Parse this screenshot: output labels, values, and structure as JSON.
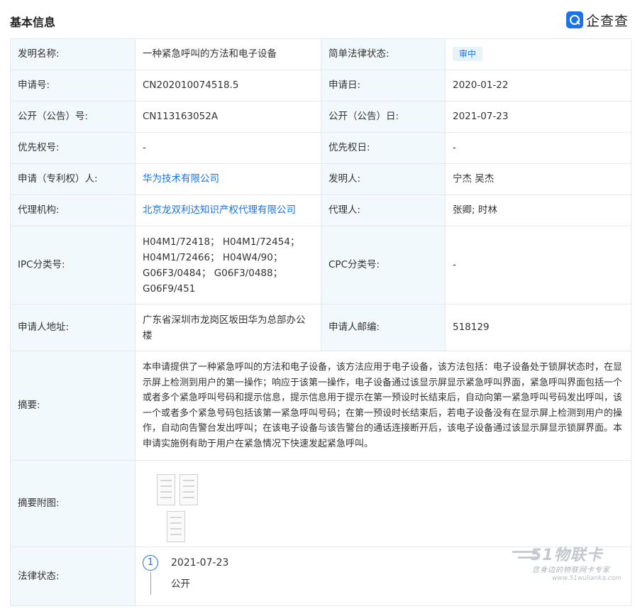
{
  "section": {
    "title": "基本信息"
  },
  "brand": {
    "name": "企查查",
    "icon": "qichacha-logo-icon"
  },
  "fields": {
    "invention_name": {
      "label": "发明名称:",
      "value": "一种紧急呼叫的方法和电子设备"
    },
    "legal_status_simple": {
      "label": "简单法律状态:",
      "value": "审中"
    },
    "application_no": {
      "label": "申请号:",
      "value": "CN202010074518.5"
    },
    "application_date": {
      "label": "申请日:",
      "value": "2020-01-22"
    },
    "publication_no": {
      "label": "公开（公告）号:",
      "value": "CN113163052A"
    },
    "publication_date": {
      "label": "公开（公告）日:",
      "value": "2021-07-23"
    },
    "priority_no": {
      "label": "优先权号:",
      "value": "-"
    },
    "priority_date": {
      "label": "优先权日:",
      "value": "-"
    },
    "applicant": {
      "label": "申请（专利权）人:",
      "value": "华为技术有限公司"
    },
    "inventor": {
      "label": "发明人:",
      "value": "宁杰 吴杰"
    },
    "agency": {
      "label": "代理机构:",
      "value": "北京龙双利达知识产权代理有限公司"
    },
    "agent": {
      "label": "代理人:",
      "value": "张卿; 时林"
    },
    "ipc": {
      "label": "IPC分类号:",
      "value": "H04M1/72418； H04M1/72454； H04M1/72466； H04W4/90； G06F3/0484； G06F3/0488； G06F9/451"
    },
    "cpc": {
      "label": "CPC分类号:",
      "value": "-"
    },
    "applicant_address": {
      "label": "申请人地址:",
      "value": "广东省深圳市龙岗区坂田华为总部办公楼"
    },
    "applicant_postcode": {
      "label": "申请人邮编:",
      "value": "518129"
    },
    "abstract": {
      "label": "摘要:",
      "value": "本申请提供了一种紧急呼叫的方法和电子设备，该方法应用于电子设备，该方法包括：电子设备处于锁屏状态时，在显示屏上检测到用户的第一操作；响应于该第一操作，电子设备通过该显示屏显示紧急呼叫界面，紧急呼叫界面包括一个或者多个紧急呼叫号码和提示信息，提示信息用于提示在第一预设时长结束后，自动向第一紧急呼叫号码发出呼叫，该一个或者多个紧急号码包括该第一紧急呼叫号码；在第一预设时长结束后，若电子设备没有在显示屏上检测到用户的操作，自动向告警台发出呼叫；在该电子设备与该告警台的通话连接断开后，该电子设备通过该显示屏显示锁屏界面。本申请实施例有助于用户在紧急情况下快速发起紧急呼叫。"
    },
    "abstract_figure": {
      "label": "摘要附图:"
    },
    "legal_status": {
      "label": "法律状态:",
      "events": [
        {
          "index": "1",
          "date": "2021-07-23",
          "status": "公开"
        }
      ]
    }
  },
  "watermark": {
    "brand": "51物联卡",
    "slogan": "您身边的物联网卡专家",
    "url": "www.51wulianka.com"
  },
  "colors": {
    "label_bg": "#f2f9fc",
    "link": "#1a73e8",
    "border": "#e4e8ee",
    "badge_bg": "#e6f3fb"
  }
}
